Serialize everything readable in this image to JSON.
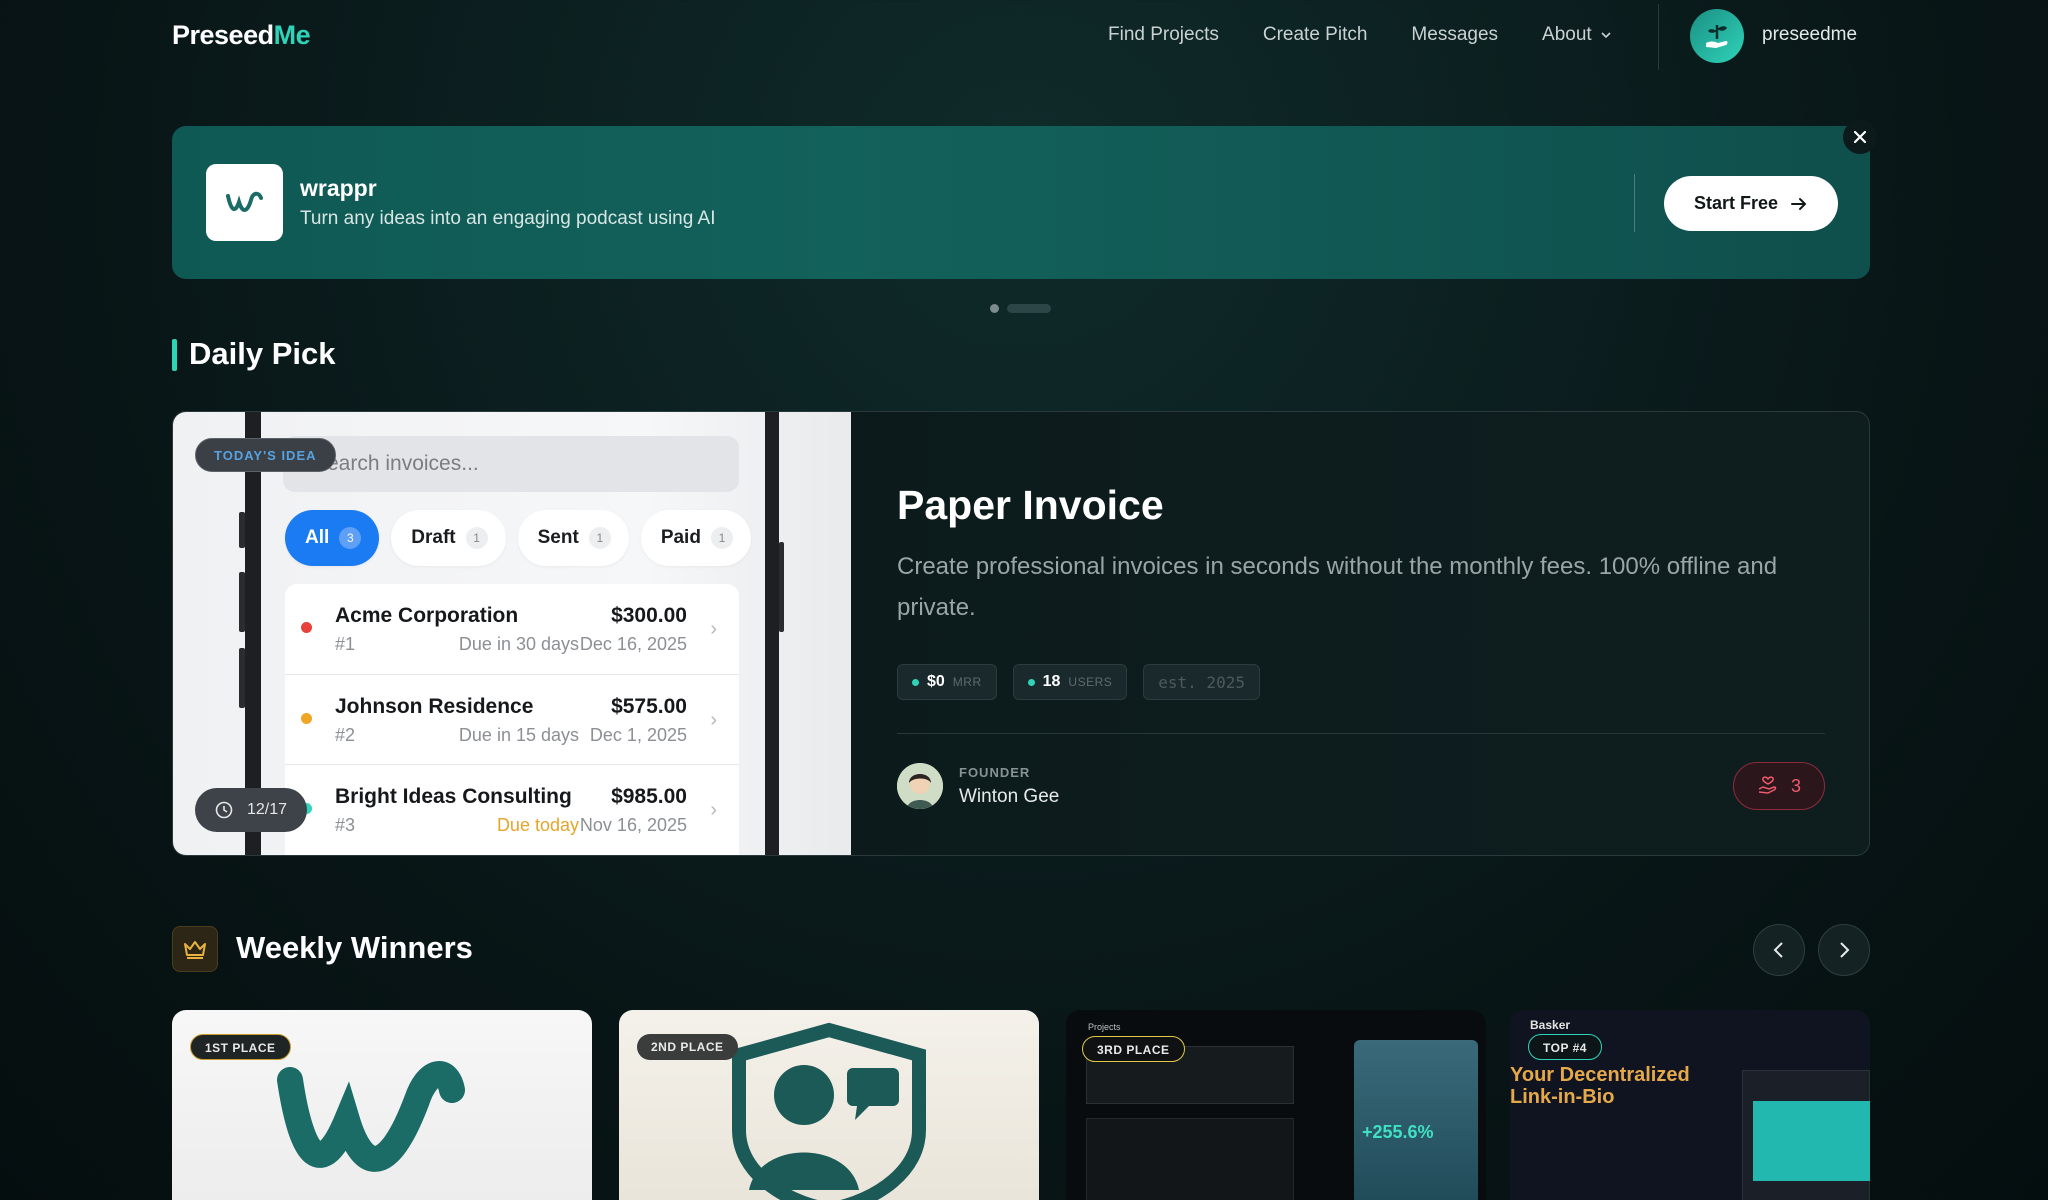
{
  "nav": {
    "logo_part1": "Preseed",
    "logo_part2": "Me",
    "links": [
      "Find Projects",
      "Create Pitch",
      "Messages",
      "About"
    ],
    "username": "preseedme"
  },
  "banner": {
    "name": "wrappr",
    "description": "Turn any ideas into an engaging podcast using AI",
    "cta_label": "Start Free",
    "close_label": "×"
  },
  "daily_pick": {
    "section_title": "Daily Pick",
    "badge": "TODAY'S IDEA",
    "counter": "12/17",
    "screenshot": {
      "search_placeholder": "Search invoices...",
      "chips": [
        {
          "label": "All",
          "count": "3"
        },
        {
          "label": "Draft",
          "count": "1"
        },
        {
          "label": "Sent",
          "count": "1"
        },
        {
          "label": "Paid",
          "count": "1"
        }
      ],
      "invoices": [
        {
          "name": "Acme Corporation",
          "number": "#1",
          "amount": "$300.00",
          "due": "Due in 30 days",
          "date": "Dec 16, 2025",
          "color": "#e8403a"
        },
        {
          "name": "Johnson Residence",
          "number": "#2",
          "amount": "$575.00",
          "due": "Due in 15 days",
          "date": "Dec 1, 2025",
          "color": "#f0a524"
        },
        {
          "name": "Bright Ideas Consulting",
          "number": "#3",
          "amount": "$985.00",
          "due": "Due today",
          "date": "Nov 16, 2025",
          "color": "#2fd3b8"
        }
      ]
    },
    "title": "Paper Invoice",
    "description": "Create professional invoices in seconds without the monthly fees. 100% offline and private.",
    "stats": {
      "mrr_value": "$0",
      "mrr_label": "MRR",
      "users_value": "18",
      "users_label": "USERS",
      "est": "est. 2025"
    },
    "founder_label": "FOUNDER",
    "founder_name": "Winton Gee",
    "votes": "3"
  },
  "weekly": {
    "section_title": "Weekly Winners",
    "cards": [
      {
        "badge": "1ST PLACE"
      },
      {
        "badge": "2ND PLACE"
      },
      {
        "badge": "3RD PLACE",
        "preview_heading": "Projects",
        "preview_stat": "+255.6%"
      },
      {
        "badge": "TOP #4",
        "brand": "Basker",
        "headline_1": "Your Decentralized",
        "headline_2": "Link-in-Bio"
      }
    ]
  },
  "colors": {
    "accent": "#2fd3b8",
    "banner_bg": "#13615b",
    "vote_red": "#ee5a6e",
    "chip_blue": "#1a7bf3"
  }
}
